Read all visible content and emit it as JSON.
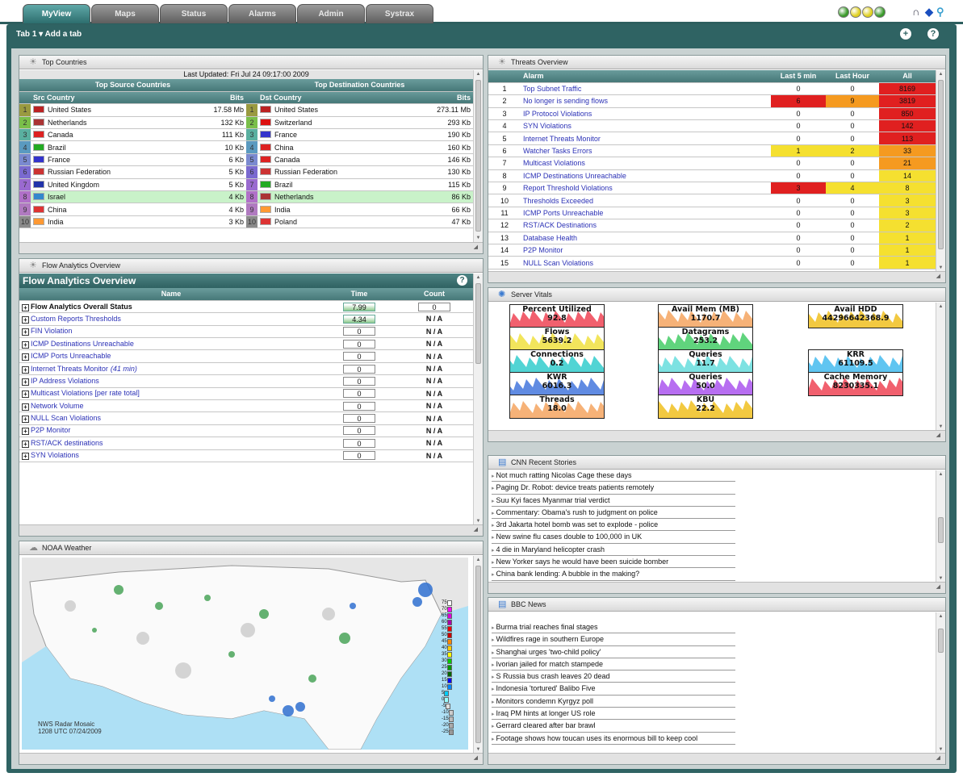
{
  "tabs": [
    "MyView",
    "Maps",
    "Status",
    "Alarms",
    "Admin",
    "Systrax"
  ],
  "active_tab": "MyView",
  "status_light_colors": [
    "#3a9a2a",
    "#e0d020",
    "#e0d020",
    "#3a9a2a"
  ],
  "tabbar": {
    "label": "Tab 1 ▾  Add a tab",
    "add_icon": "+",
    "help_icon": "?"
  },
  "top_countries": {
    "title": "Top Countries",
    "updated": "Last Updated: Fri Jul 24 09:17:00 2009",
    "src_heading": "Top Source Countries",
    "dst_heading": "Top Destination Countries",
    "src_col": "Src Country",
    "dst_col": "Dst Country",
    "bits_col": "Bits",
    "rows": [
      {
        "rank": "1",
        "src": "United States",
        "src_bits": "17.58 Mb",
        "dst": "United States",
        "dst_bits": "273.11 Mb"
      },
      {
        "rank": "2",
        "src": "Netherlands",
        "src_bits": "132 Kb",
        "dst": "Switzerland",
        "dst_bits": "293 Kb"
      },
      {
        "rank": "3",
        "src": "Canada",
        "src_bits": "111 Kb",
        "dst": "France",
        "dst_bits": "190 Kb"
      },
      {
        "rank": "4",
        "src": "Brazil",
        "src_bits": "10 Kb",
        "dst": "China",
        "dst_bits": "160 Kb"
      },
      {
        "rank": "5",
        "src": "France",
        "src_bits": "6 Kb",
        "dst": "Canada",
        "dst_bits": "146 Kb"
      },
      {
        "rank": "6",
        "src": "Russian Federation",
        "src_bits": "5 Kb",
        "dst": "Russian Federation",
        "dst_bits": "130 Kb"
      },
      {
        "rank": "7",
        "src": "United Kingdom",
        "src_bits": "5 Kb",
        "dst": "Brazil",
        "dst_bits": "115 Kb"
      },
      {
        "rank": "8",
        "src": "Israel",
        "src_bits": "4 Kb",
        "dst": "Netherlands",
        "dst_bits": "86 Kb"
      },
      {
        "rank": "9",
        "src": "China",
        "src_bits": "4 Kb",
        "dst": "India",
        "dst_bits": "66 Kb"
      },
      {
        "rank": "10",
        "src": "India",
        "src_bits": "3 Kb",
        "dst": "Poland",
        "dst_bits": "47 Kb"
      }
    ]
  },
  "flow_analytics": {
    "panel_title": "Flow Analytics Overview",
    "heading": "Flow Analytics Overview",
    "cols": [
      "Name",
      "Time",
      "Count"
    ],
    "rows": [
      {
        "name": "Flow Analytics Overall Status",
        "time": "7.99",
        "count": "0"
      },
      {
        "name": "Custom Reports Thresholds",
        "time": "4.34",
        "count": "N / A"
      },
      {
        "name": "FIN Violation",
        "time": "0",
        "count": "N / A"
      },
      {
        "name": "ICMP Destinations Unreachable",
        "time": "0",
        "count": "N / A"
      },
      {
        "name": "ICMP Ports Unreachable",
        "time": "0",
        "count": "N / A"
      },
      {
        "name": "Internet Threats Monitor",
        "note": "(41 min)",
        "time": "0",
        "count": "N / A"
      },
      {
        "name": "IP Address Violations",
        "time": "0",
        "count": "N / A"
      },
      {
        "name": "Multicast Violations [per rate total]",
        "time": "0",
        "count": "N / A"
      },
      {
        "name": "Network Volume",
        "time": "0",
        "count": "N / A"
      },
      {
        "name": "NULL Scan Violations",
        "time": "0",
        "count": "N / A"
      },
      {
        "name": "P2P Monitor",
        "time": "0",
        "count": "N / A"
      },
      {
        "name": "RST/ACK destinations",
        "time": "0",
        "count": "N / A"
      },
      {
        "name": "SYN Violations",
        "time": "0",
        "count": "N / A"
      }
    ]
  },
  "weather": {
    "title": "NOAA Weather",
    "caption1": "NWS Radar Mosaic",
    "caption2": "1208 UTC 07/24/2009",
    "legend": [
      "75",
      "70",
      "65",
      "60",
      "55",
      "50",
      "45",
      "40",
      "35",
      "30",
      "25",
      "20",
      "15",
      "10",
      "5",
      "0",
      "-5",
      "-10",
      "-15",
      "-20",
      "-25"
    ]
  },
  "threats": {
    "title": "Threats Overview",
    "cols": [
      "Alarm",
      "Last 5 min",
      "Last Hour",
      "All"
    ],
    "rows": [
      {
        "n": "1",
        "alarm": "Top Subnet Traffic",
        "l5": "0",
        "lh": "0",
        "all": "8169"
      },
      {
        "n": "2",
        "alarm": "No longer is sending flows",
        "l5": "6",
        "lh": "9",
        "all": "3819"
      },
      {
        "n": "3",
        "alarm": "IP Protocol Violations",
        "l5": "0",
        "lh": "0",
        "all": "850"
      },
      {
        "n": "4",
        "alarm": "SYN Violations",
        "l5": "0",
        "lh": "0",
        "all": "142"
      },
      {
        "n": "5",
        "alarm": "Internet Threats Monitor",
        "l5": "0",
        "lh": "0",
        "all": "113"
      },
      {
        "n": "6",
        "alarm": "Watcher Tasks Errors",
        "l5": "1",
        "lh": "2",
        "all": "33"
      },
      {
        "n": "7",
        "alarm": "Multicast Violations",
        "l5": "0",
        "lh": "0",
        "all": "21"
      },
      {
        "n": "8",
        "alarm": "ICMP Destinations Unreachable",
        "l5": "0",
        "lh": "0",
        "all": "14"
      },
      {
        "n": "9",
        "alarm": "Report Threshold Violations",
        "l5": "3",
        "lh": "4",
        "all": "8"
      },
      {
        "n": "10",
        "alarm": "Thresholds Exceeded",
        "l5": "0",
        "lh": "0",
        "all": "3"
      },
      {
        "n": "11",
        "alarm": "ICMP Ports Unreachable",
        "l5": "0",
        "lh": "0",
        "all": "3"
      },
      {
        "n": "12",
        "alarm": "RST/ACK Destinations",
        "l5": "0",
        "lh": "0",
        "all": "2"
      },
      {
        "n": "13",
        "alarm": "Database Health",
        "l5": "0",
        "lh": "0",
        "all": "1"
      },
      {
        "n": "14",
        "alarm": "P2P Monitor",
        "l5": "0",
        "lh": "0",
        "all": "1"
      },
      {
        "n": "15",
        "alarm": "NULL Scan Violations",
        "l5": "0",
        "lh": "0",
        "all": "1"
      }
    ]
  },
  "server_vitals": {
    "title": "Server Vitals",
    "items": [
      {
        "label": "Percent Utilized",
        "value": "92.8",
        "color": "#ee4455"
      },
      {
        "label": "Flows",
        "value": "5639.2",
        "color": "#f0e040"
      },
      {
        "label": "Connections",
        "value": "0.2",
        "color": "#33cccc"
      },
      {
        "label": "KWR",
        "value": "6016.3",
        "color": "#4477dd"
      },
      {
        "label": "Threads",
        "value": "18.0",
        "color": "#f5a560"
      },
      {
        "label": "Avail Mem (MB)",
        "value": "1170.7",
        "color": "#f5a560"
      },
      {
        "label": "Datagrams",
        "value": "253.2",
        "color": "#44cc66"
      },
      {
        "label": "Queries",
        "value": "11.7",
        "color": "#66dddd"
      },
      {
        "label": "Queries",
        "value": "50.0",
        "color": "#aa55ee"
      },
      {
        "label": "KBU",
        "value": "22.2",
        "color": "#f0c020"
      },
      {
        "label": "Avail HDD",
        "value": "44296642368.9",
        "color": "#f0c020"
      },
      {
        "label": "KRR",
        "value": "61109.5",
        "color": "#44bbee"
      },
      {
        "label": "Cache Memory",
        "value": "8230335.1",
        "color": "#ee4455"
      }
    ]
  },
  "cnn": {
    "title": "CNN Recent Stories",
    "items": [
      "Not much ratting Nicolas Cage these days",
      "Paging Dr. Robot: device treats patients remotely",
      "Suu Kyi faces Myanmar trial verdict",
      "Commentary: Obama's rush to judgment on police",
      "3rd Jakarta hotel bomb was set to explode - police",
      "New swine flu cases double to 100,000 in UK",
      "4 die in Maryland helicopter crash",
      "New Yorker says he would have been suicide bomber",
      "China bank lending: A bubble in the making?"
    ]
  },
  "bbc": {
    "title": "BBC News",
    "items": [
      "Burma trial reaches final stages",
      "Wildfires rage in southern Europe",
      "Shanghai urges 'two-child policy'",
      "Ivorian jailed for match stampede",
      "S Russia bus crash leaves 20 dead",
      "Indonesia 'tortured' Balibo Five",
      "Monitors condemn Kyrgyz poll",
      "Iraq PM hints at longer US role",
      "Gerrard cleared after bar brawl",
      "Footage shows how toucan uses its enormous bill to keep cool"
    ]
  }
}
